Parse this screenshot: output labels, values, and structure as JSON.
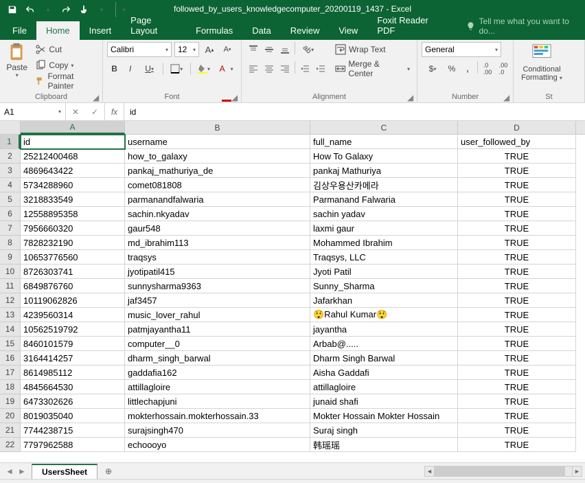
{
  "app": {
    "title": "followed_by_users_knowledgecomputer_20200119_1437 - Excel"
  },
  "qat": {
    "save": "Save",
    "undo": "Undo",
    "redo": "Redo"
  },
  "tabs": {
    "file": "File",
    "home": "Home",
    "insert": "Insert",
    "pagelayout": "Page Layout",
    "formulas": "Formulas",
    "data": "Data",
    "review": "Review",
    "view": "View",
    "foxit": "Foxit Reader PDF",
    "tellme": "Tell me what you want to do..."
  },
  "ribbon": {
    "clipboard": {
      "label": "Clipboard",
      "paste": "Paste",
      "cut": "Cut",
      "copy": "Copy",
      "formatpainter": "Format Painter"
    },
    "font": {
      "label": "Font",
      "name": "Calibri",
      "size": "12"
    },
    "alignment": {
      "label": "Alignment",
      "wrap": "Wrap Text",
      "merge": "Merge & Center"
    },
    "number": {
      "label": "Number",
      "format": "General"
    },
    "styles": {
      "label": "St",
      "conditional": "Conditional",
      "formatting": "Formatting"
    }
  },
  "namebox": {
    "ref": "A1"
  },
  "formula": {
    "value": "id"
  },
  "columns": [
    "A",
    "B",
    "C",
    "D"
  ],
  "headers": {
    "A": "id",
    "B": "username",
    "C": "full_name",
    "D": "user_followed_by"
  },
  "rows": [
    {
      "n": 1,
      "A": "id",
      "B": "username",
      "C": "full_name",
      "D": "user_followed_by"
    },
    {
      "n": 2,
      "A": "25212400468",
      "B": "how_to_galaxy",
      "C": "How To Galaxy",
      "D": "TRUE"
    },
    {
      "n": 3,
      "A": "4869643422",
      "B": "pankaj_mathuriya_de",
      "C": "pankaj Mathuriya",
      "D": "TRUE"
    },
    {
      "n": 4,
      "A": "5734288960",
      "B": "comet081808",
      "C": "김상우용산카메라",
      "D": "TRUE"
    },
    {
      "n": 5,
      "A": "3218833549",
      "B": "parmanandfalwaria",
      "C": "Parmanand Falwaria",
      "D": "TRUE"
    },
    {
      "n": 6,
      "A": "12558895358",
      "B": "sachin.nkyadav",
      "C": "sachin yadav",
      "D": "TRUE"
    },
    {
      "n": 7,
      "A": "7956660320",
      "B": "gaur548",
      "C": "laxmi gaur",
      "D": "TRUE"
    },
    {
      "n": 8,
      "A": "7828232190",
      "B": "md_ibrahim113",
      "C": "Mohammed Ibrahim",
      "D": "TRUE"
    },
    {
      "n": 9,
      "A": "10653776560",
      "B": "traqsys",
      "C": "Traqsys, LLC",
      "D": "TRUE"
    },
    {
      "n": 10,
      "A": "8726303741",
      "B": "jyotipatil415",
      "C": "Jyoti Patil",
      "D": "TRUE"
    },
    {
      "n": 11,
      "A": "6849876760",
      "B": "sunnysharma9363",
      "C": "Sunny_Sharma",
      "D": "TRUE"
    },
    {
      "n": 12,
      "A": "10119062826",
      "B": "jaf3457",
      "C": "Jafarkhan",
      "D": "TRUE"
    },
    {
      "n": 13,
      "A": "4239560314",
      "B": "music_lover_rahul",
      "C": "😲Rahul Kumar😲",
      "D": "TRUE"
    },
    {
      "n": 14,
      "A": "10562519792",
      "B": "patmjayantha11",
      "C": "jayantha",
      "D": "TRUE"
    },
    {
      "n": 15,
      "A": "8460101579",
      "B": "computer__0",
      "C": "Arbab@.....",
      "D": "TRUE"
    },
    {
      "n": 16,
      "A": "3164414257",
      "B": "dharm_singh_barwal",
      "C": "Dharm Singh Barwal",
      "D": "TRUE"
    },
    {
      "n": 17,
      "A": "8614985112",
      "B": "gaddafia162",
      "C": "Aisha Gaddafi",
      "D": "TRUE"
    },
    {
      "n": 18,
      "A": "4845664530",
      "B": "attillagloire",
      "C": "attillagloire",
      "D": "TRUE"
    },
    {
      "n": 19,
      "A": "6473302626",
      "B": "littlechapjuni",
      "C": "junaid shafi",
      "D": "TRUE"
    },
    {
      "n": 20,
      "A": "8019035040",
      "B": "mokterhossain.mokterhossain.33",
      "C": "Mokter Hossain Mokter Hossain",
      "D": "TRUE"
    },
    {
      "n": 21,
      "A": "7744238715",
      "B": "surajsingh470",
      "C": "Suraj singh",
      "D": "TRUE"
    },
    {
      "n": 22,
      "A": "7797962588",
      "B": "echoooyo",
      "C": "韩瑶瑶",
      "D": "TRUE"
    }
  ],
  "sheet": {
    "name": "UsersSheet"
  }
}
